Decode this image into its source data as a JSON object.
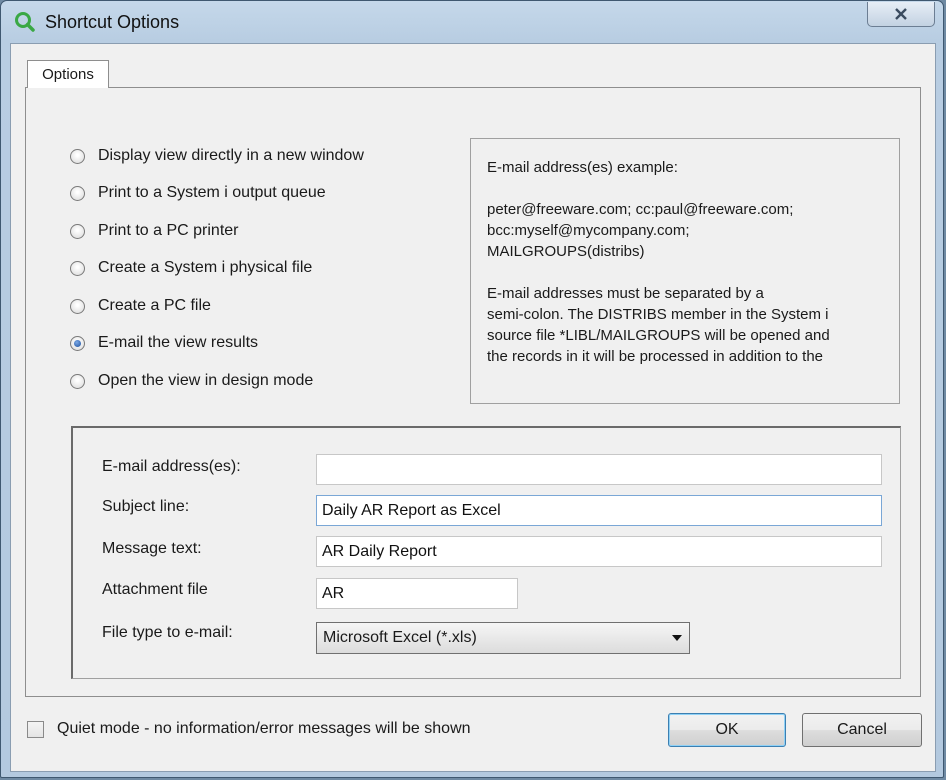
{
  "window": {
    "title": "Shortcut Options"
  },
  "tabs": [
    {
      "label": "Options"
    }
  ],
  "output_options": [
    {
      "label": "Display view directly in a new window",
      "selected": false
    },
    {
      "label": "Print to a System i output queue",
      "selected": false
    },
    {
      "label": "Print to a PC printer",
      "selected": false
    },
    {
      "label": "Create a System i physical file",
      "selected": false
    },
    {
      "label": "Create a PC file",
      "selected": false
    },
    {
      "label": "E-mail the view results",
      "selected": true
    },
    {
      "label": "Open the view in design mode",
      "selected": false
    }
  ],
  "help": {
    "heading": "E-mail address(es) example:",
    "example": "peter@freeware.com; cc:paul@freeware.com;\nbcc:myself@mycompany.com;\nMAILGROUPS(distribs)",
    "note": "E-mail addresses must be separated by a\nsemi-colon. The DISTRIBS member in the System i\nsource file *LIBL/MAILGROUPS will be opened and\nthe records in it will be processed in addition to the"
  },
  "email_form": {
    "address": {
      "label": "E-mail address(es):",
      "value": ""
    },
    "subject": {
      "label": "Subject line:",
      "value": "Daily AR Report as Excel"
    },
    "message": {
      "label": "Message text:",
      "value": "AR Daily Report"
    },
    "attachment": {
      "label": "Attachment file",
      "value": "AR"
    },
    "file_type": {
      "label": "File type to e-mail:",
      "selected": "Microsoft Excel  (*.xls)"
    }
  },
  "quiet_mode": {
    "label": "Quiet mode - no information/error messages will be shown",
    "checked": false
  },
  "buttons": {
    "ok": "OK",
    "cancel": "Cancel"
  },
  "icons": {
    "app": "search-icon",
    "close": "close-icon",
    "dropdown": "chevron-down-icon"
  },
  "colors": {
    "accent": "#3c7fb1",
    "app_icon": "#3aa845"
  }
}
